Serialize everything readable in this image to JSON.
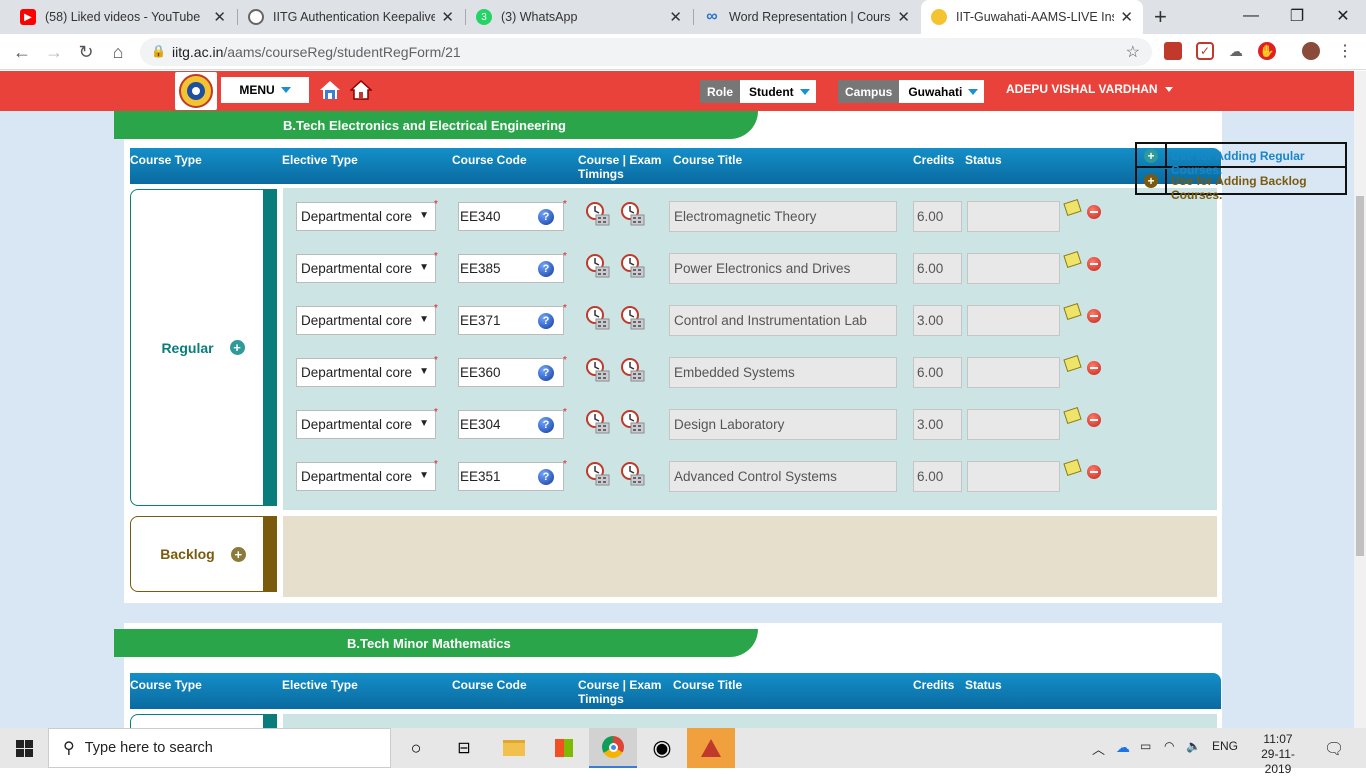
{
  "browser": {
    "tabs": [
      {
        "title": "(58) Liked videos - YouTube",
        "icon": "youtube-icon",
        "active": false
      },
      {
        "title": "IITG Authentication Keepalive W",
        "icon": "globe-icon",
        "active": false
      },
      {
        "title": "(3) WhatsApp",
        "icon": "whatsapp-icon",
        "active": false
      },
      {
        "title": "Word Representation | Coursera",
        "icon": "coursera-icon",
        "active": false
      },
      {
        "title": "IIT-Guwahati-AAMS-LIVE Instance",
        "icon": "iitg-icon",
        "active": true
      }
    ],
    "url_host": "iitg.ac.in",
    "url_path": "/aams/courseReg/studentRegForm/21"
  },
  "header": {
    "menu_label": "MENU",
    "role_label": "Role",
    "role_value": "Student",
    "campus_label": "Campus",
    "campus_value": "Guwahati",
    "user_name": "ADEPU VISHAL VARDHAN"
  },
  "legend": {
    "regular": "Use for Adding Regular Courses.",
    "backlog": "Use for Adding Backlog Courses."
  },
  "columns": {
    "course_type": "Course Type",
    "elective_type": "Elective Type",
    "course_code": "Course Code",
    "exam": "Course | Exam",
    "exam2": "Timings",
    "course_title": "Course Title",
    "credits": "Credits",
    "status": "Status"
  },
  "program1": {
    "name": "B.Tech Electronics and Electrical Engineering",
    "regular_label": "Regular",
    "backlog_label": "Backlog",
    "rows": [
      {
        "elective": "Departmental core",
        "code": "EE340",
        "title": "Electromagnetic Theory",
        "credits": "6.00",
        "status": ""
      },
      {
        "elective": "Departmental core",
        "code": "EE385",
        "title": "Power Electronics and Drives",
        "credits": "6.00",
        "status": ""
      },
      {
        "elective": "Departmental core",
        "code": "EE371",
        "title": "Control and Instrumentation Lab",
        "credits": "3.00",
        "status": ""
      },
      {
        "elective": "Departmental core",
        "code": "EE360",
        "title": "Embedded Systems",
        "credits": "6.00",
        "status": ""
      },
      {
        "elective": "Departmental core",
        "code": "EE304",
        "title": "Design Laboratory",
        "credits": "3.00",
        "status": ""
      },
      {
        "elective": "Departmental core",
        "code": "EE351",
        "title": "Advanced Control Systems",
        "credits": "6.00",
        "status": ""
      }
    ]
  },
  "program2": {
    "name": "B.Tech Minor Mathematics"
  },
  "taskbar": {
    "search_placeholder": "Type here to search",
    "language": "ENG",
    "time": "11:07",
    "date": "29-11-2019"
  },
  "colors": {
    "header_red": "#e9423a",
    "green_banner": "#2ba54a",
    "table_header_blue": "#0a76ad",
    "regular_teal": "#0b7c7c",
    "backlog_brown": "#7a5a0c",
    "regular_panel": "#cce4e4",
    "backlog_panel": "#e6dfcb"
  }
}
